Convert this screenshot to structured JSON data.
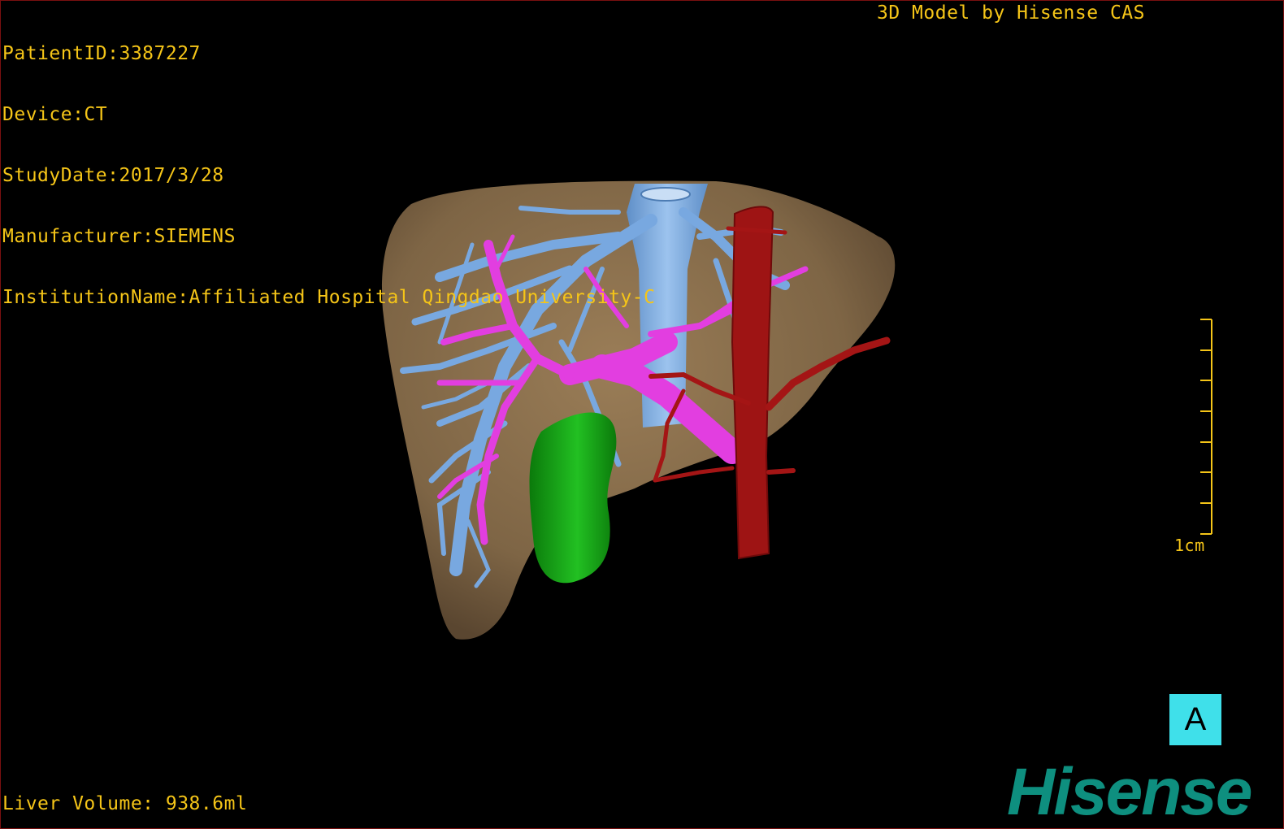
{
  "header": {
    "patient_id": "PatientID:3387227",
    "device": "Device:CT",
    "study_date": "StudyDate:2017/3/28",
    "manufacturer": "Manufacturer:SIEMENS",
    "institution": "InstitutionName:Affiliated Hospital Qingdao University-C"
  },
  "credit": "3D Model by Hisense CAS",
  "scale_bar": {
    "label": "1cm",
    "ticks": 8
  },
  "footer": {
    "liver_volume": "Liver Volume: 938.6ml"
  },
  "view_badge": "A",
  "brand": "Hisense",
  "structures": [
    {
      "name": "liver",
      "color": "#8a7150"
    },
    {
      "name": "hepatic-veins",
      "color": "#78a8e0"
    },
    {
      "name": "portal-vein",
      "color": "#e23ee0"
    },
    {
      "name": "hepatic-artery",
      "color": "#9e1414"
    },
    {
      "name": "gallbladder",
      "color": "#16a516"
    }
  ],
  "colors": {
    "overlay_text": "#f5c518",
    "badge": "#3fe0ea",
    "brand": "#0e8f7f"
  }
}
